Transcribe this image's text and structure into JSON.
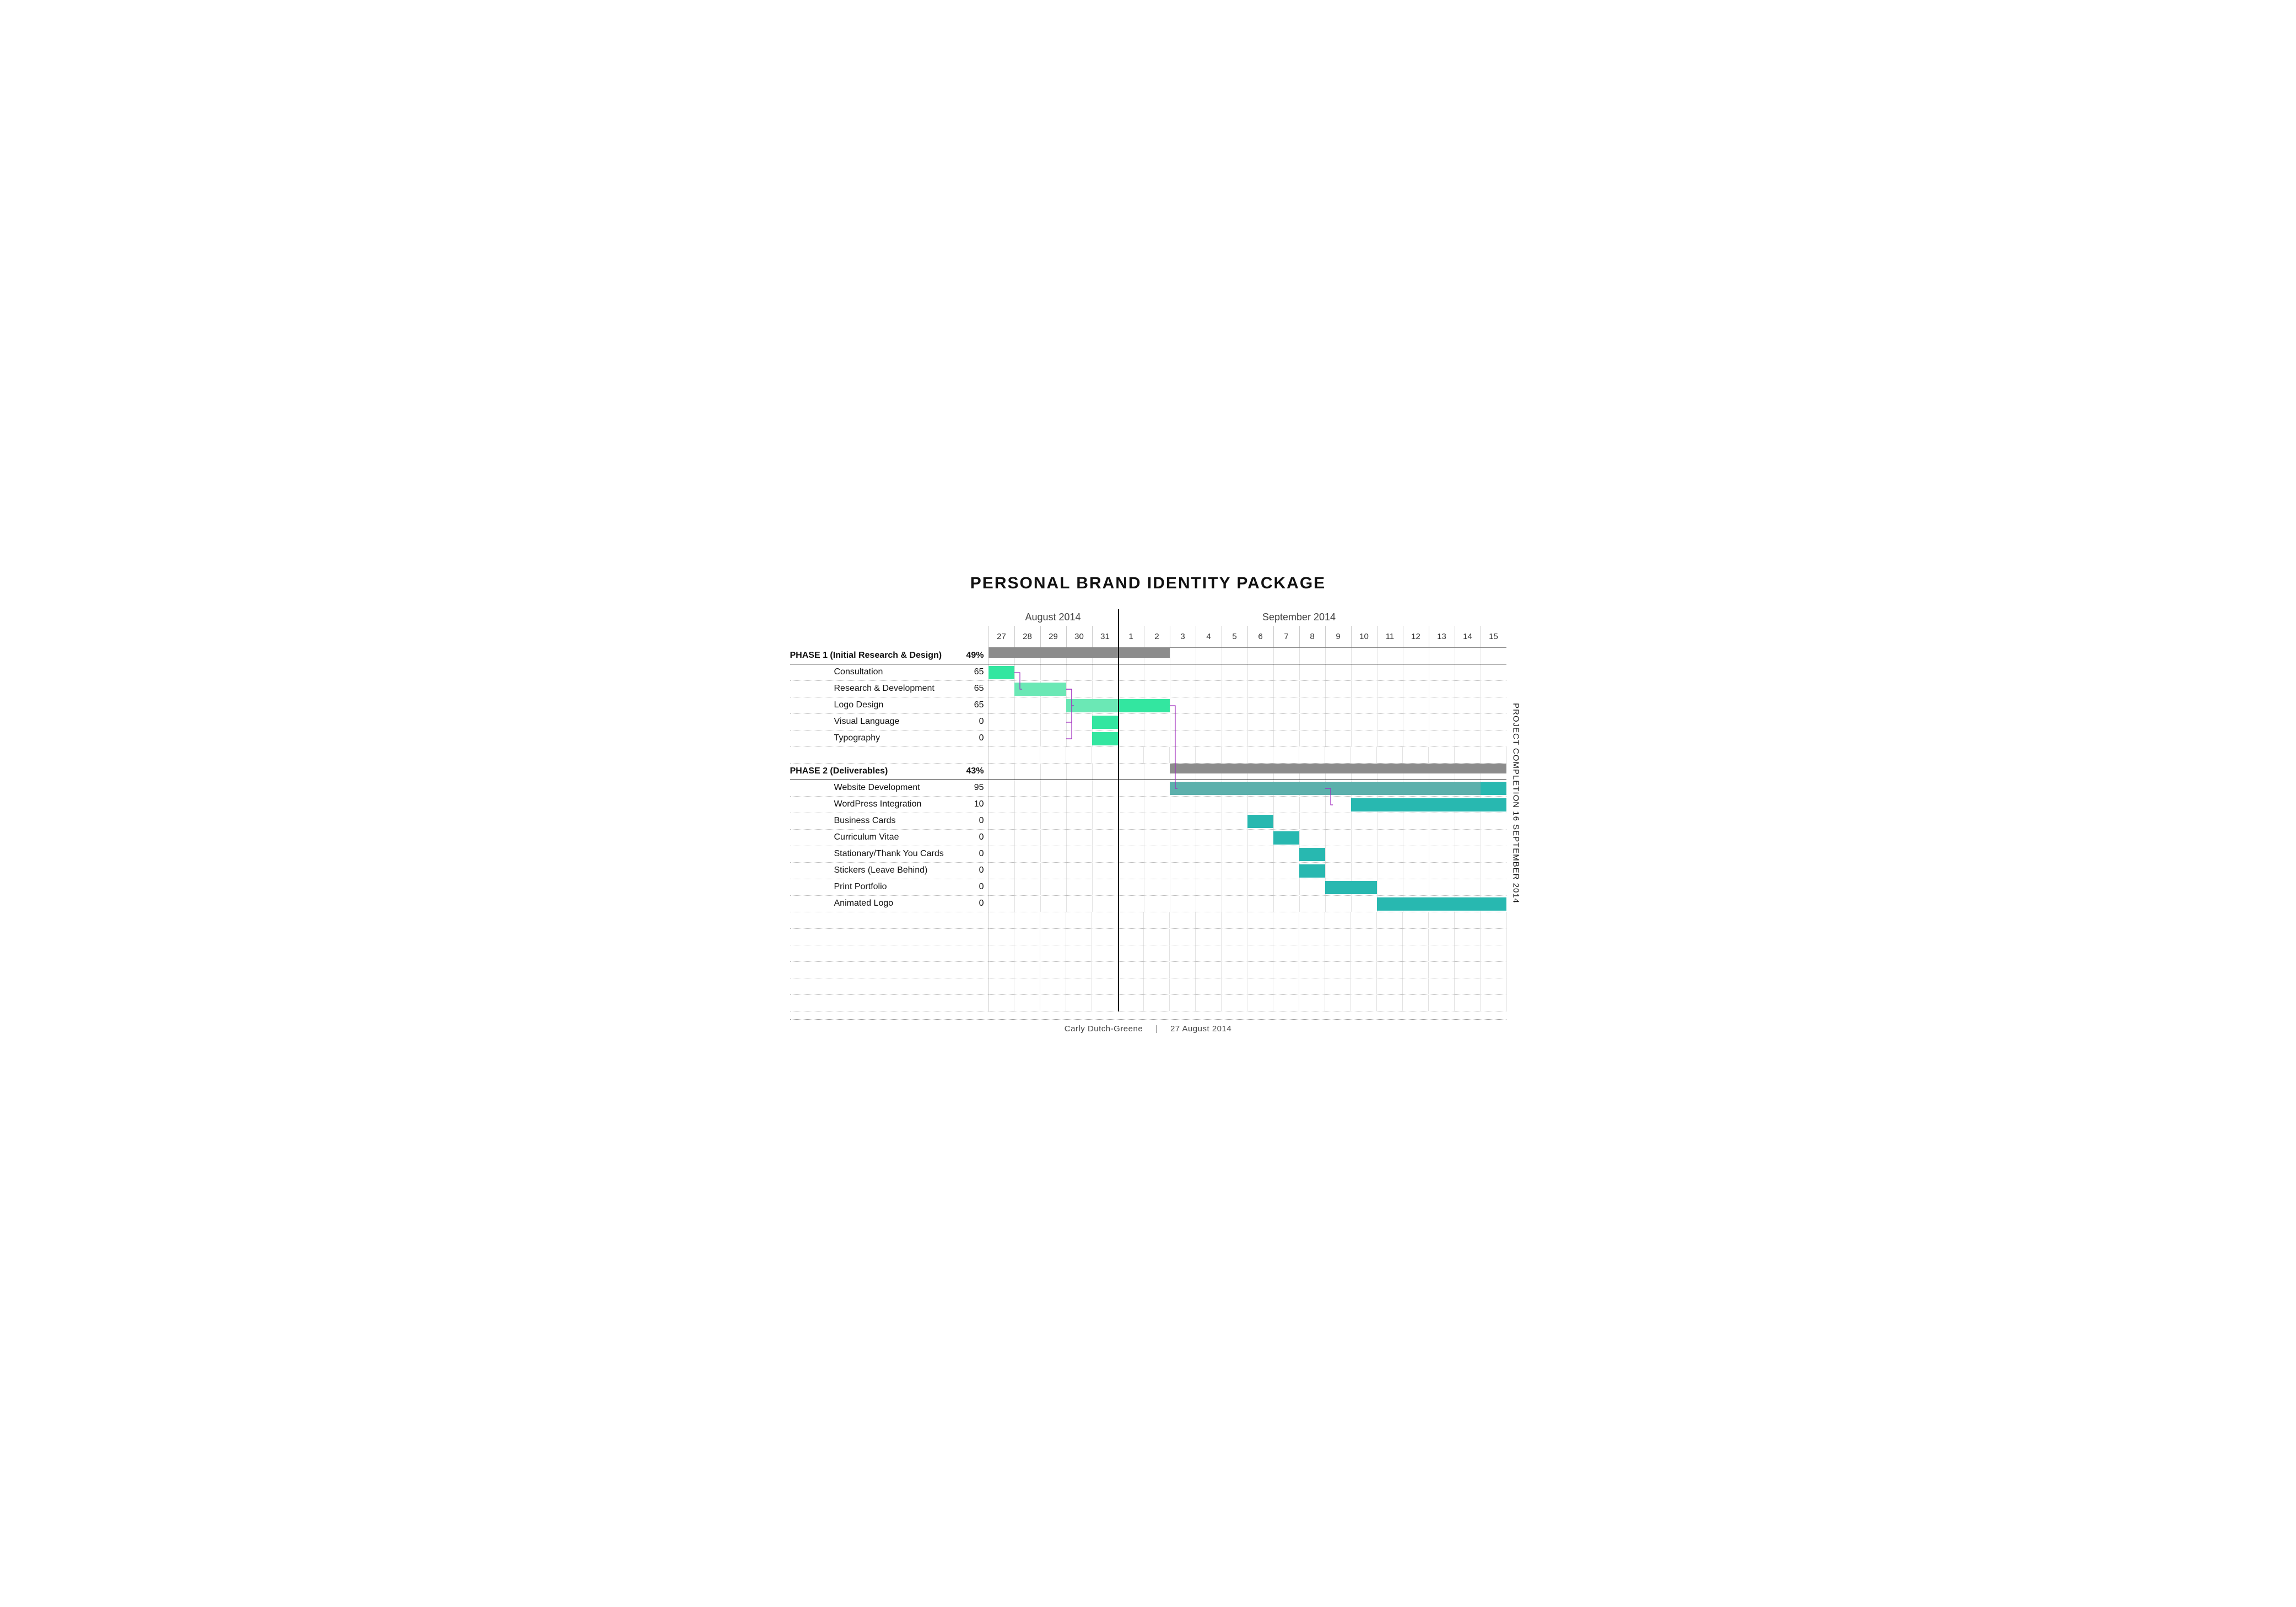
{
  "title": "PERSONAL BRAND IDENTITY PACKAGE",
  "side_note": "PROJECT COMPLETION 16 SEPTEMBER 2014",
  "footer": {
    "author": "Carly Dutch-Greene",
    "date": "27 August 2014"
  },
  "timeline": {
    "months": [
      {
        "label": "August 2014",
        "center_day_index": 2.5
      },
      {
        "label": "September 2014",
        "center_day_index": 12
      }
    ],
    "days": [
      "27",
      "28",
      "29",
      "30",
      "31",
      "1",
      "2",
      "3",
      "4",
      "5",
      "6",
      "7",
      "8",
      "9",
      "10",
      "11",
      "12",
      "13",
      "14",
      "15"
    ]
  },
  "chart_data": {
    "type": "gantt",
    "title": "PERSONAL BRAND IDENTITY PACKAGE",
    "x_unit": "day index (0 = 27 Aug 2014)",
    "xlim": [
      0,
      20
    ],
    "today_index": 5,
    "rows": [
      {
        "kind": "phase",
        "label": "PHASE 1 (Initial Research & Design)",
        "value": "49%",
        "bars": [
          {
            "start": 0,
            "end": 7,
            "style": "grey"
          }
        ]
      },
      {
        "kind": "task",
        "label": "Consultation",
        "value": "65",
        "bars": [
          {
            "start": 0,
            "end": 1,
            "style": "green"
          }
        ]
      },
      {
        "kind": "task",
        "label": "Research & Development",
        "value": "65",
        "bars": [
          {
            "start": 1,
            "end": 3,
            "style": "green-l"
          }
        ]
      },
      {
        "kind": "task",
        "label": "Logo Design",
        "value": "65",
        "bars": [
          {
            "start": 3,
            "end": 5,
            "style": "green-l"
          },
          {
            "start": 5,
            "end": 7,
            "style": "green"
          }
        ]
      },
      {
        "kind": "task",
        "label": "Visual Language",
        "value": "0",
        "bars": [
          {
            "start": 4,
            "end": 5,
            "style": "green"
          }
        ]
      },
      {
        "kind": "task",
        "label": "Typography",
        "value": "0",
        "bars": [
          {
            "start": 4,
            "end": 5,
            "style": "green"
          }
        ]
      },
      {
        "kind": "blank"
      },
      {
        "kind": "phase",
        "label": "PHASE 2 (Deliverables)",
        "value": "43%",
        "bars": [
          {
            "start": 7,
            "end": 20,
            "style": "grey"
          }
        ]
      },
      {
        "kind": "task",
        "label": "Website Development",
        "value": "95",
        "bars": [
          {
            "start": 7,
            "end": 19,
            "style": "teal-d"
          },
          {
            "start": 19,
            "end": 20,
            "style": "teal"
          }
        ]
      },
      {
        "kind": "task",
        "label": "WordPress Integration",
        "value": "10",
        "bars": [
          {
            "start": 14,
            "end": 20,
            "style": "teal"
          }
        ]
      },
      {
        "kind": "task",
        "label": "Business Cards",
        "value": "0",
        "bars": [
          {
            "start": 10,
            "end": 11,
            "style": "teal"
          }
        ]
      },
      {
        "kind": "task",
        "label": "Curriculum Vitae",
        "value": "0",
        "bars": [
          {
            "start": 11,
            "end": 12,
            "style": "teal"
          }
        ]
      },
      {
        "kind": "task",
        "label": "Stationary/Thank You Cards",
        "value": "0",
        "bars": [
          {
            "start": 12,
            "end": 13,
            "style": "teal"
          }
        ]
      },
      {
        "kind": "task",
        "label": "Stickers (Leave Behind)",
        "value": "0",
        "bars": [
          {
            "start": 12,
            "end": 13,
            "style": "teal"
          }
        ]
      },
      {
        "kind": "task",
        "label": "Print Portfolio",
        "value": "0",
        "bars": [
          {
            "start": 13,
            "end": 15,
            "style": "teal"
          }
        ]
      },
      {
        "kind": "task",
        "label": "Animated Logo",
        "value": "0",
        "bars": [
          {
            "start": 15,
            "end": 20,
            "style": "teal"
          }
        ]
      },
      {
        "kind": "blank"
      },
      {
        "kind": "blank"
      },
      {
        "kind": "blank"
      },
      {
        "kind": "blank"
      },
      {
        "kind": "blank"
      },
      {
        "kind": "blank"
      }
    ],
    "dependencies": [
      {
        "from_row": 1,
        "from_day": 1,
        "to_row": 2,
        "to_day": 1.3
      },
      {
        "from_row": 2,
        "from_day": 3,
        "to_row": 3,
        "to_day": 3.3
      },
      {
        "from_row": 2,
        "from_day": 3,
        "to_row": 4,
        "to_day": 3.0
      },
      {
        "from_row": 2,
        "from_day": 3,
        "to_row": 5,
        "to_day": 3.0
      },
      {
        "from_row": 3,
        "from_day": 7,
        "to_row": 8,
        "to_day": 7.3
      },
      {
        "from_row": 8,
        "from_day": 13,
        "to_row": 9,
        "to_day": 13.3
      }
    ]
  }
}
